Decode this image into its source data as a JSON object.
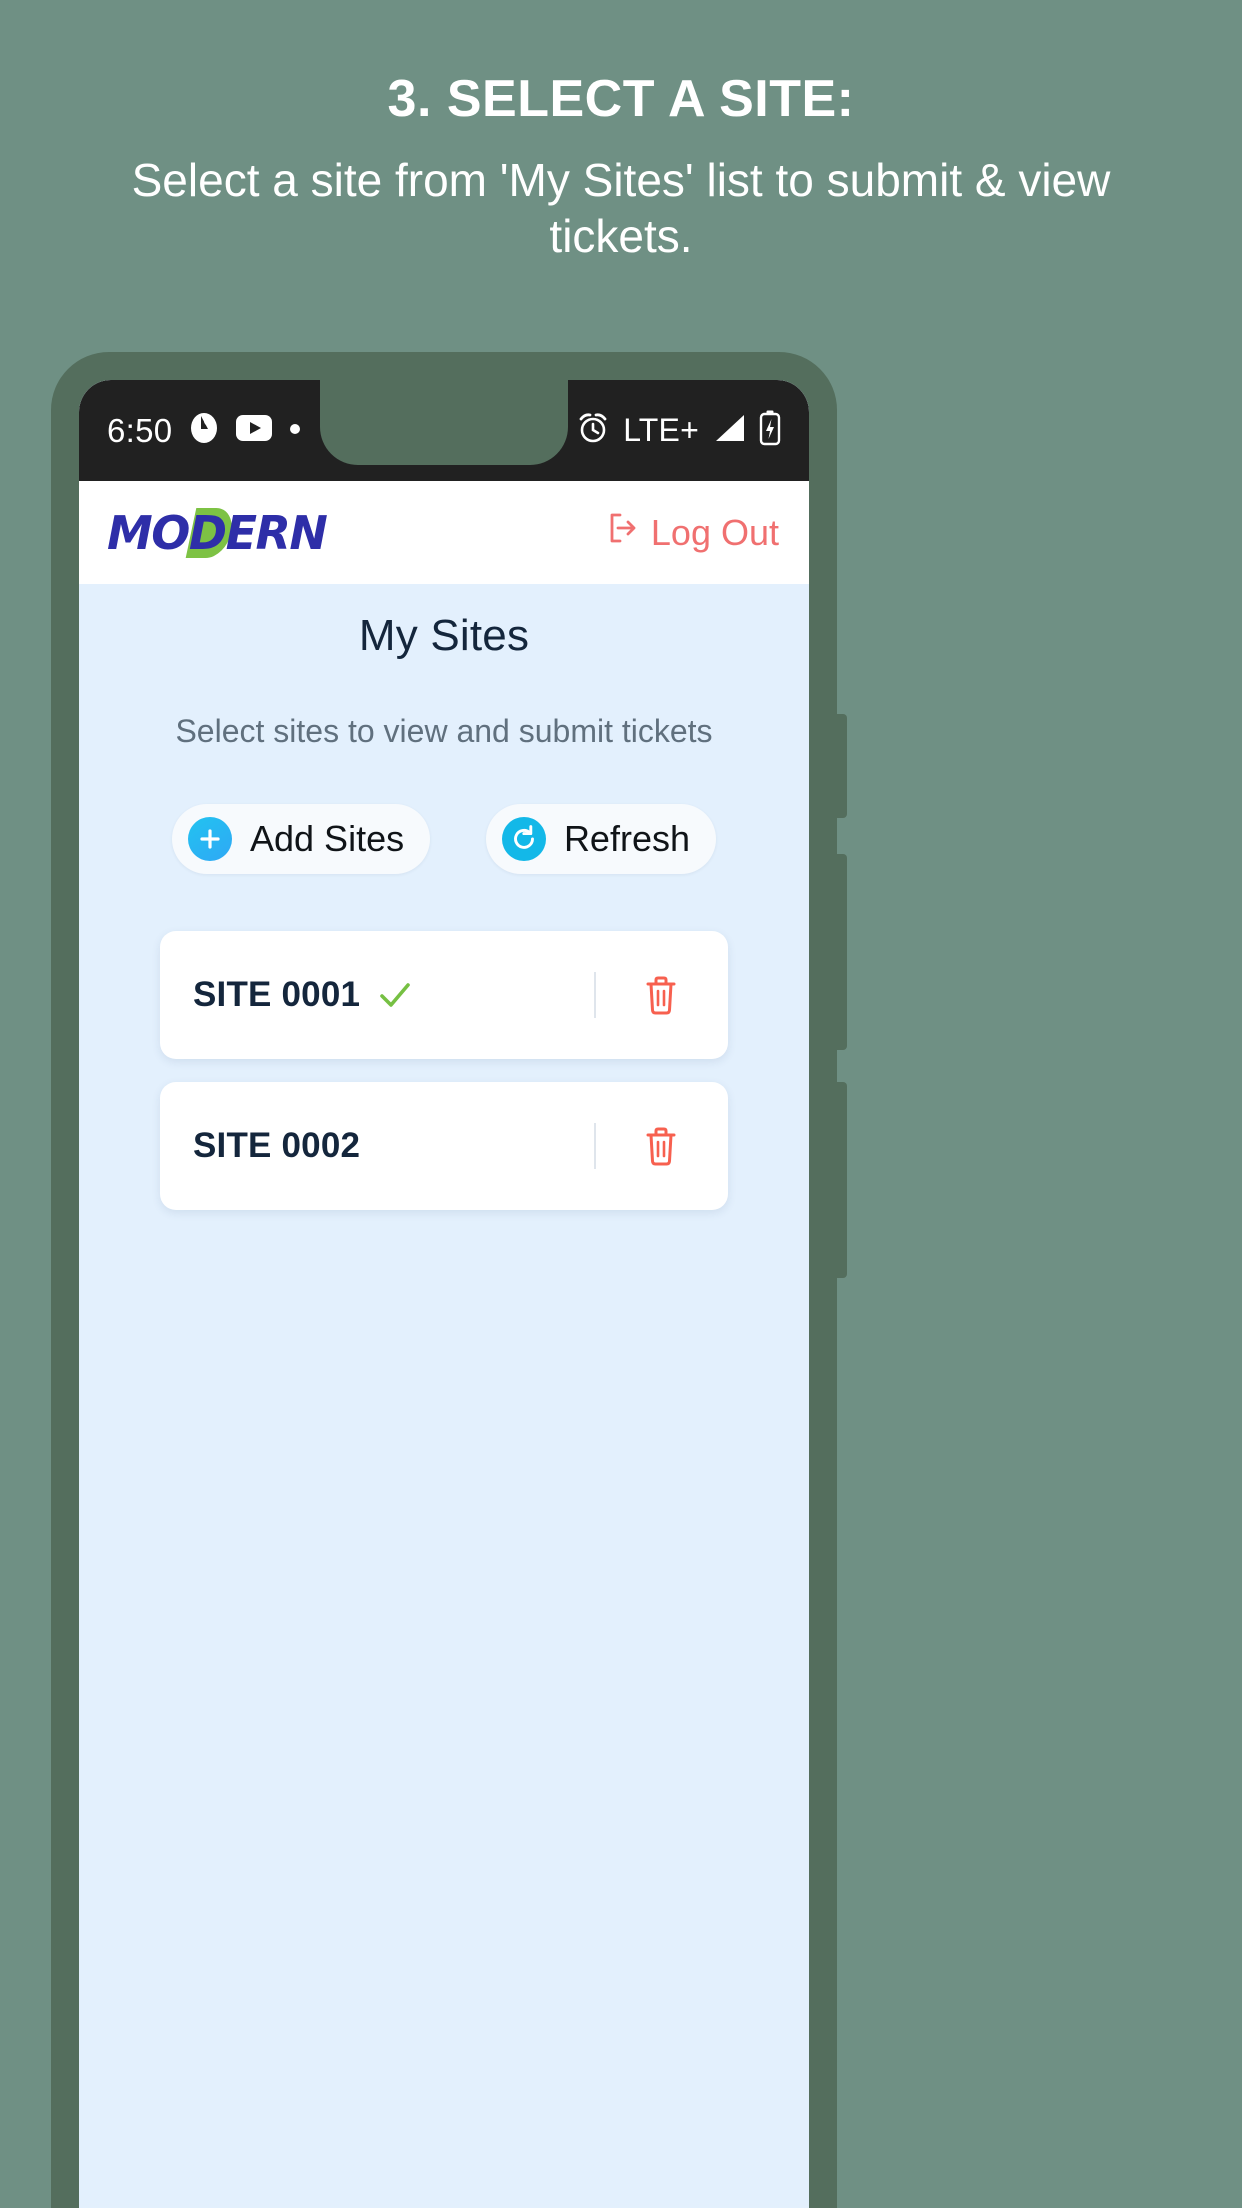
{
  "promo": {
    "title": "3. SELECT A SITE:",
    "subtitle": "Select a site from 'My Sites' list to submit & view tickets."
  },
  "statusbar": {
    "time": "6:50",
    "network": "LTE+",
    "icons_left": [
      "ana-app-icon",
      "youtube-icon",
      "dot-indicator-icon"
    ],
    "icons_right": [
      "alarm-icon",
      "signal-icon",
      "battery-charging-icon"
    ]
  },
  "app_header": {
    "logo_text": "MODERN",
    "logout_label": "Log Out"
  },
  "main": {
    "title": "My Sites",
    "subtitle": "Select sites to view and submit tickets",
    "add_button": "Add Sites",
    "refresh_button": "Refresh",
    "sites": [
      {
        "name": "SITE 0001",
        "selected": true
      },
      {
        "name": "SITE 0002",
        "selected": false
      }
    ]
  },
  "colors": {
    "background": "#6f9084",
    "device_frame": "#546e5d",
    "screen_bg": "#e3f0fd",
    "statusbar_bg": "#212121",
    "logo_blue": "#2e2ea8",
    "logo_green": "#7dc244",
    "logout_red": "#f07070",
    "accent_cyan": "#13b8e8",
    "check_green": "#76c043",
    "trash_red": "#f7604f",
    "title_navy": "#14263c",
    "subtitle_gray": "#60707e"
  }
}
